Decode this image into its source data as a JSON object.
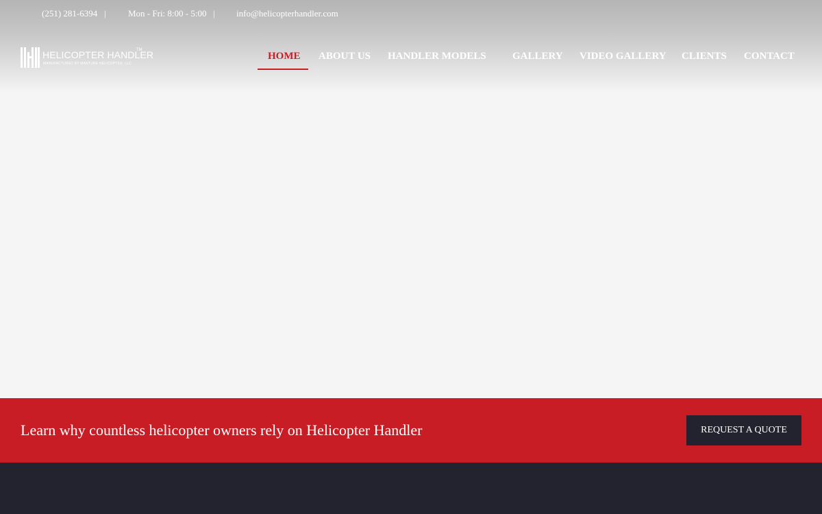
{
  "topbar": {
    "phone": "(251) 281-6394",
    "separator": "|",
    "hours": "Mon - Fri: 8:00 - 5:00",
    "email": "info@helicopterhandler.com"
  },
  "logo": {
    "name": "HELICOPTER HANDLER",
    "trademark": "TM",
    "tagline": "MANUFACTURED BY MANTURE HELICOPTER, LLC"
  },
  "nav": {
    "items": [
      {
        "label": "HOME",
        "active": true
      },
      {
        "label": "ABOUT US"
      },
      {
        "label": "HANDLER MODELS"
      },
      {
        "label": "GALLERY"
      },
      {
        "label": "VIDEO GALLERY"
      },
      {
        "label": "CLIENTS"
      },
      {
        "label": "CONTACT"
      }
    ]
  },
  "cta": {
    "text": "Learn why countless helicopter owners rely on Helicopter Handler",
    "button_label": "REQUEST A QUOTE"
  },
  "colors": {
    "accent_red": "#c91d25",
    "dark_navy": "#23232f",
    "hero_bg": "#f5f5f5"
  }
}
